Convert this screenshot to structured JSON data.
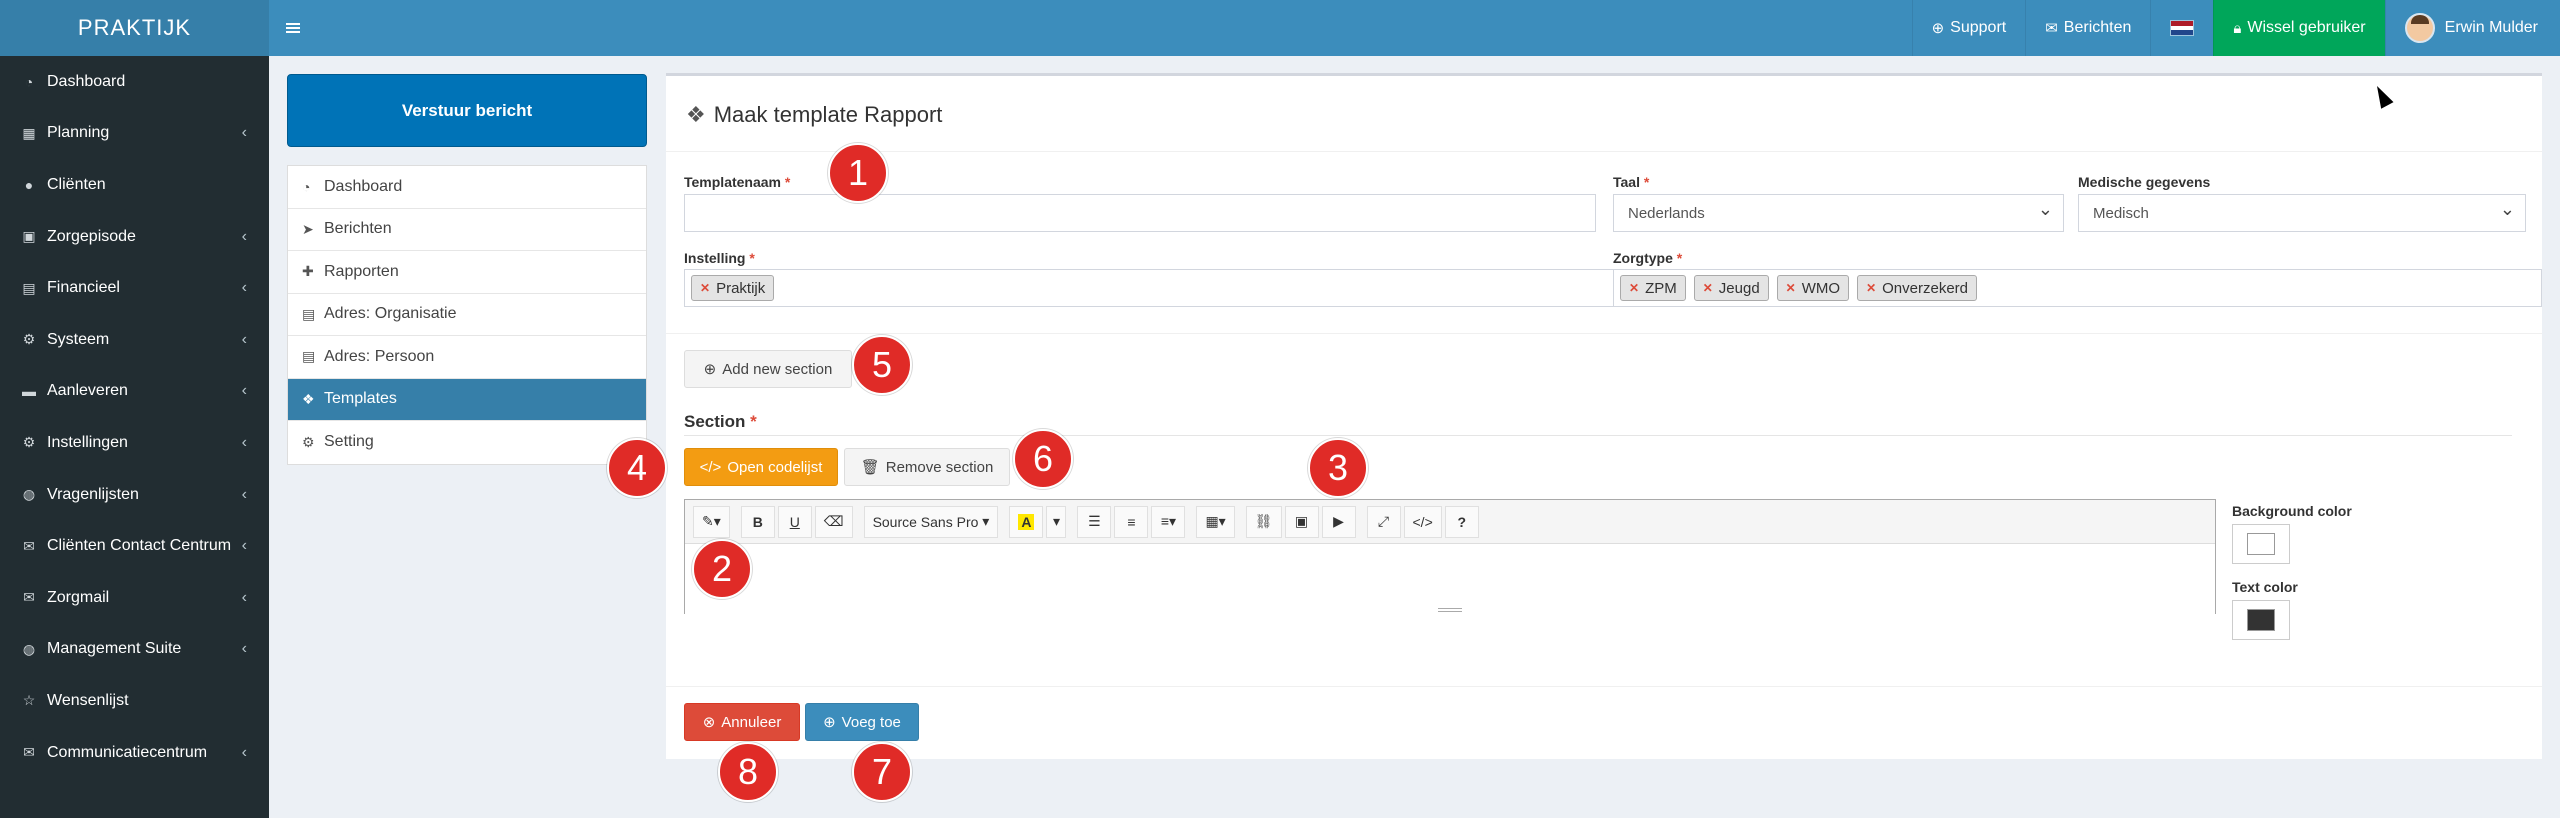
{
  "header": {
    "logo": "PRAKTIJK",
    "support": "Support",
    "messages": "Berichten",
    "switch_user": "Wissel gebruiker",
    "user_name": "Erwin Mulder"
  },
  "sidebar": {
    "items": [
      {
        "label": "Dashboard",
        "icon": "dashboard-icon",
        "glyph": "◔",
        "chevron": ""
      },
      {
        "label": "Planning",
        "icon": "calendar-icon",
        "glyph": "▦",
        "chevron": "‹"
      },
      {
        "label": "Cliënten",
        "icon": "user-icon",
        "glyph": "●",
        "chevron": ""
      },
      {
        "label": "Zorgepisode",
        "icon": "medkit-icon",
        "glyph": "▣",
        "chevron": "‹"
      },
      {
        "label": "Financieel",
        "icon": "book-icon",
        "glyph": "▤",
        "chevron": "‹"
      },
      {
        "label": "Systeem",
        "icon": "cogs-icon",
        "glyph": "⚙",
        "chevron": "‹"
      },
      {
        "label": "Aanleveren",
        "icon": "truck-icon",
        "glyph": "▬",
        "chevron": "‹"
      },
      {
        "label": "Instellingen",
        "icon": "gear-icon",
        "glyph": "⚙",
        "chevron": "‹"
      },
      {
        "label": "Vragenlijsten",
        "icon": "globe-icon",
        "glyph": "◍",
        "chevron": "‹"
      },
      {
        "label": "Cliënten Contact Centrum",
        "icon": "envelope-icon",
        "glyph": "✉",
        "chevron": "‹"
      },
      {
        "label": "Zorgmail",
        "icon": "envelope-icon",
        "glyph": "✉",
        "chevron": "‹"
      },
      {
        "label": "Management Suite",
        "icon": "globe-icon",
        "glyph": "◍",
        "chevron": "‹"
      },
      {
        "label": "Wensenlijst",
        "icon": "star-icon",
        "glyph": "☆",
        "chevron": ""
      },
      {
        "label": "Communicatiecentrum",
        "icon": "envelope-icon",
        "glyph": "✉",
        "chevron": "‹"
      }
    ]
  },
  "send_button": "Verstuur bericht",
  "subnav": {
    "items": [
      {
        "label": "Dashboard",
        "icon": "dashboard-icon",
        "glyph": "◔"
      },
      {
        "label": "Berichten",
        "icon": "paper-plane-icon",
        "glyph": "➤"
      },
      {
        "label": "Rapporten",
        "icon": "puzzle-icon",
        "glyph": "✚"
      },
      {
        "label": "Adres: Organisatie",
        "icon": "book-icon",
        "glyph": "▤"
      },
      {
        "label": "Adres: Persoon",
        "icon": "book-icon",
        "glyph": "▤"
      },
      {
        "label": "Templates",
        "icon": "cubes-icon",
        "glyph": "❖"
      },
      {
        "label": "Setting",
        "icon": "cogs-icon",
        "glyph": "⚙"
      }
    ]
  },
  "form": {
    "title": "Maak template Rapport",
    "template_name_label": "Templatenaam",
    "template_name_value": "",
    "language_label": "Taal",
    "language_value": "Nederlands",
    "medical_label": "Medische gegevens",
    "medical_value": "Medisch",
    "institution_label": "Instelling",
    "institution_tags": [
      "Praktijk"
    ],
    "care_type_label": "Zorgtype",
    "care_type_tags": [
      "ZPM",
      "Jeugd",
      "WMO",
      "Onverzekerd"
    ],
    "required_mark": "*",
    "add_section": "Add new section",
    "section_label": "Section",
    "open_codelist": "Open codelijst",
    "remove_section": "Remove section",
    "font_name": "Source Sans Pro",
    "background_color_label": "Background color",
    "background_color": "#ffffff",
    "text_color_label": "Text color",
    "text_color": "#333333",
    "cancel": "Annuleer",
    "add": "Voeg toe"
  },
  "callouts": [
    "1",
    "2",
    "3",
    "4",
    "5",
    "6",
    "7",
    "8"
  ],
  "colors": {
    "header": "#3c8dbc",
    "sidebar": "#222d32",
    "green": "#00a65a",
    "orange": "#f39c12",
    "red": "#dd4b39",
    "callout": "#e02b27"
  }
}
